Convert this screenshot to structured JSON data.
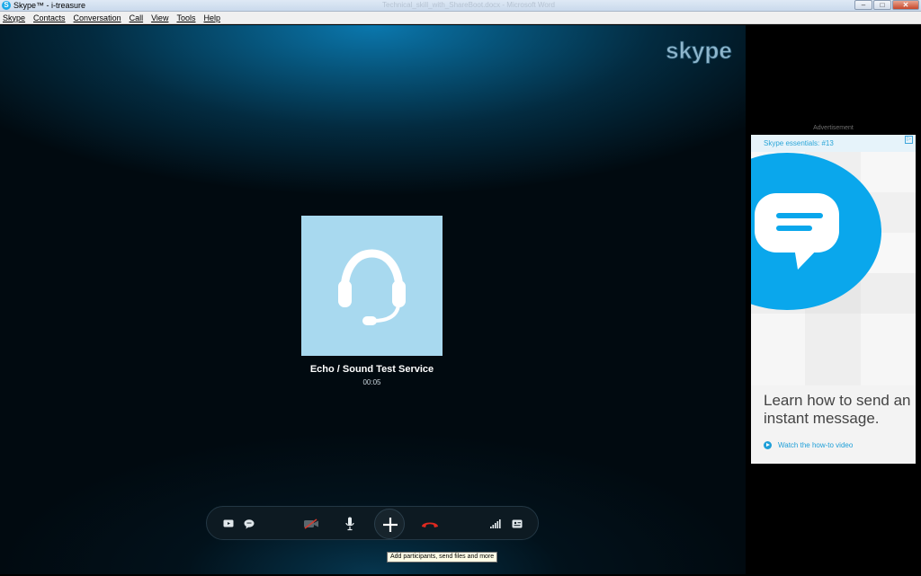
{
  "window": {
    "title": "Skype™ - i-treasure",
    "background_title": "Technical_skill_with_ShareBoot.docx - Microsoft Word",
    "controls": [
      "minimize",
      "maximize",
      "close"
    ]
  },
  "menu": [
    "Skype",
    "Contacts",
    "Conversation",
    "Call",
    "View",
    "Tools",
    "Help"
  ],
  "call": {
    "brand": "skype",
    "contact_name": "Echo / Sound Test Service",
    "duration": "00:05",
    "avatar_icon": "headset-icon",
    "controls": [
      {
        "name": "show-call-window",
        "icon": "screen-icon"
      },
      {
        "name": "instant-message",
        "icon": "chat-bubble-icon"
      },
      {
        "name": "video-off",
        "icon": "video-off-icon"
      },
      {
        "name": "microphone",
        "icon": "microphone-icon"
      },
      {
        "name": "add-participants",
        "icon": "plus-icon"
      },
      {
        "name": "end-call",
        "icon": "hang-up-icon",
        "color": "#e0291f"
      },
      {
        "name": "call-quality",
        "icon": "signal-bars-icon"
      },
      {
        "name": "more-options",
        "icon": "dialpad-icon"
      }
    ],
    "tooltip": "Add participants, send files and more"
  },
  "ad": {
    "label": "Advertisement",
    "header": "Skype essentials: #13",
    "headline": "Learn how to send an instant message.",
    "link": "Watch the how-to video",
    "accent": "#0aa7ec"
  }
}
